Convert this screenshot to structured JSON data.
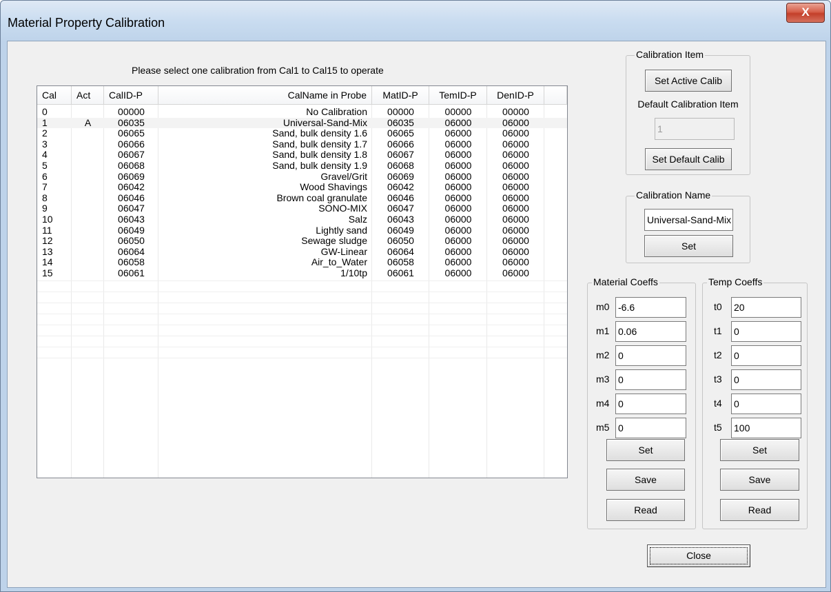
{
  "window": {
    "title": "Material Property Calibration",
    "close_glyph": "X"
  },
  "instruction": "Please select one calibration from Cal1 to Cal15 to operate",
  "table": {
    "columns": [
      "Cal",
      "Act",
      "CalID-P",
      "CalName in Probe",
      "MatID-P",
      "TemID-P",
      "DenID-P"
    ],
    "rows": [
      [
        "0",
        "",
        "00000",
        "No Calibration",
        "00000",
        "00000",
        "00000"
      ],
      [
        "1",
        "A",
        "06035",
        "Universal-Sand-Mix",
        "06035",
        "06000",
        "06000"
      ],
      [
        "2",
        "",
        "06065",
        "Sand, bulk density 1.6",
        "06065",
        "06000",
        "06000"
      ],
      [
        "3",
        "",
        "06066",
        "Sand, bulk density 1.7",
        "06066",
        "06000",
        "06000"
      ],
      [
        "4",
        "",
        "06067",
        "Sand, bulk density 1.8",
        "06067",
        "06000",
        "06000"
      ],
      [
        "5",
        "",
        "06068",
        "Sand, bulk density 1.9",
        "06068",
        "06000",
        "06000"
      ],
      [
        "6",
        "",
        "06069",
        "Gravel/Grit",
        "06069",
        "06000",
        "06000"
      ],
      [
        "7",
        "",
        "06042",
        "Wood Shavings",
        "06042",
        "06000",
        "06000"
      ],
      [
        "8",
        "",
        "06046",
        "Brown coal granulate",
        "06046",
        "06000",
        "06000"
      ],
      [
        "9",
        "",
        "06047",
        "SONO-MIX",
        "06047",
        "06000",
        "06000"
      ],
      [
        "10",
        "",
        "06043",
        "Salz",
        "06043",
        "06000",
        "06000"
      ],
      [
        "11",
        "",
        "06049",
        "Lightly sand",
        "06049",
        "06000",
        "06000"
      ],
      [
        "12",
        "",
        "06050",
        "Sewage sludge",
        "06050",
        "06000",
        "06000"
      ],
      [
        "13",
        "",
        "06064",
        "GW-Linear",
        "06064",
        "06000",
        "06000"
      ],
      [
        "14",
        "",
        "06058",
        "Air_to_Water",
        "06058",
        "06000",
        "06000"
      ],
      [
        "15",
        "",
        "06061",
        "1/10tp",
        "06061",
        "06000",
        "06000"
      ]
    ],
    "selected_row": 1
  },
  "calibration_item": {
    "legend": "Calibration Item",
    "set_active_label": "Set Active Calib",
    "default_label": "Default Calibration Item",
    "default_value": "1",
    "set_default_label": "Set Default Calib"
  },
  "calibration_name": {
    "legend": "Calibration Name",
    "value": "Universal-Sand-Mix",
    "set_label": "Set"
  },
  "material_coeffs": {
    "legend": "Material Coeffs",
    "items": [
      {
        "label": "m0",
        "value": "-6.6"
      },
      {
        "label": "m1",
        "value": "0.06"
      },
      {
        "label": "m2",
        "value": "0"
      },
      {
        "label": "m3",
        "value": "0"
      },
      {
        "label": "m4",
        "value": "0"
      },
      {
        "label": "m5",
        "value": "0"
      }
    ],
    "set_label": "Set",
    "save_label": "Save",
    "read_label": "Read"
  },
  "temp_coeffs": {
    "legend": "Temp Coeffs",
    "items": [
      {
        "label": "t0",
        "value": "20"
      },
      {
        "label": "t1",
        "value": "0"
      },
      {
        "label": "t2",
        "value": "0"
      },
      {
        "label": "t3",
        "value": "0"
      },
      {
        "label": "t4",
        "value": "0"
      },
      {
        "label": "t5",
        "value": "100"
      }
    ],
    "set_label": "Set",
    "save_label": "Save",
    "read_label": "Read"
  },
  "close_button_label": "Close"
}
